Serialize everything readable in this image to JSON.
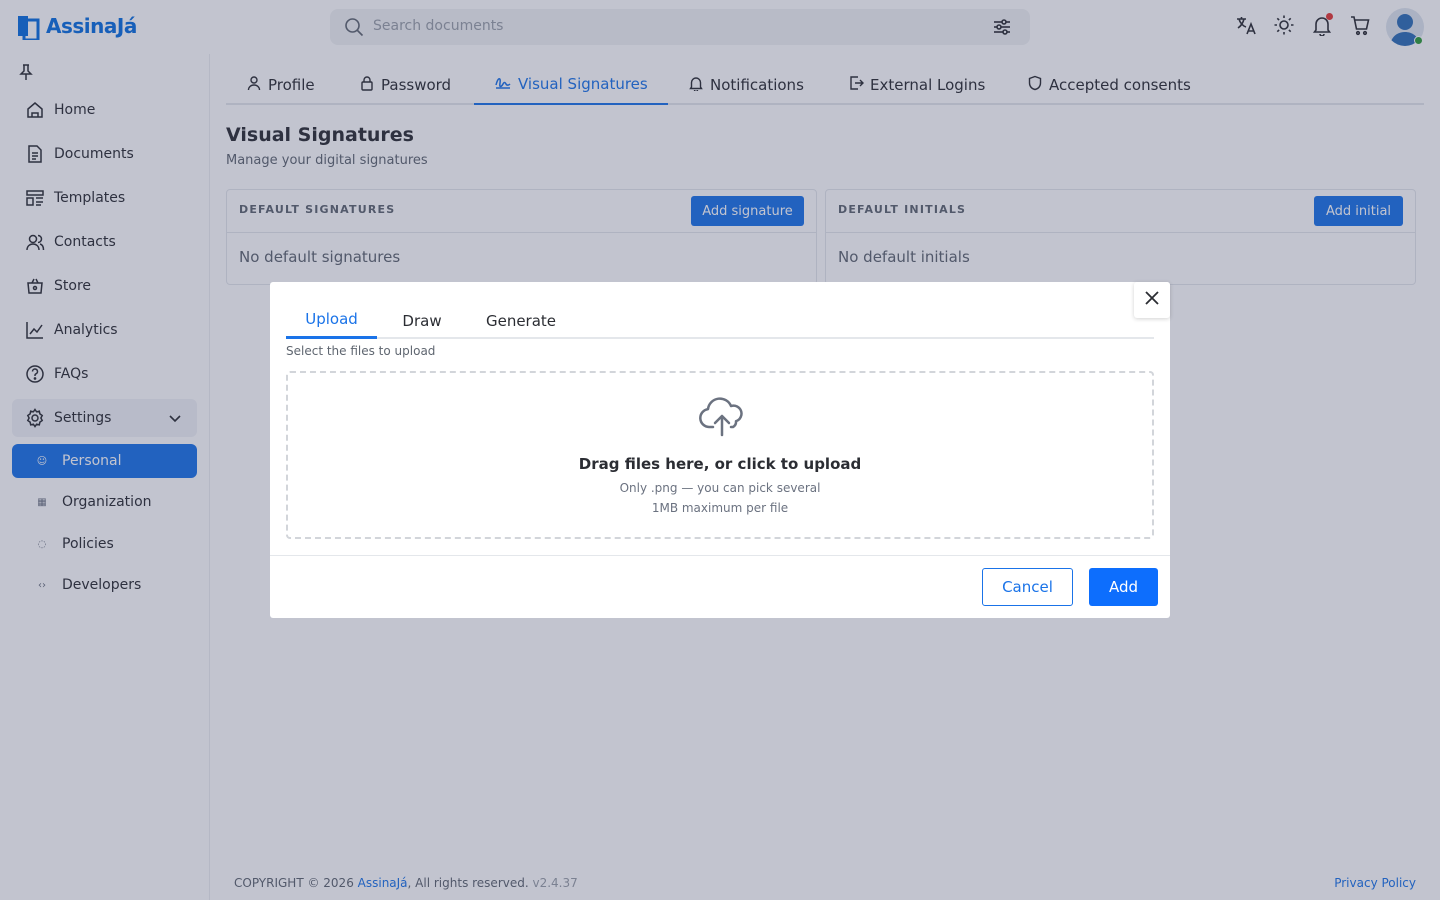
{
  "app": {
    "name": "AssinaJá"
  },
  "colors": {
    "accent": "#1a73e8",
    "primary_button": "#0d6efd",
    "overlay": "#343a60"
  },
  "header": {
    "search_placeholder": "Search documents",
    "icons": [
      "translate-icon",
      "sun-icon",
      "bell-icon",
      "cart-icon",
      "avatar"
    ]
  },
  "sidebar": {
    "items": [
      {
        "label": "Home",
        "icon": "home-icon"
      },
      {
        "label": "Documents",
        "icon": "document-icon"
      },
      {
        "label": "Templates",
        "icon": "template-icon"
      },
      {
        "label": "Contacts",
        "icon": "contacts-icon"
      },
      {
        "label": "Store",
        "icon": "store-icon"
      },
      {
        "label": "Analytics",
        "icon": "analytics-icon"
      },
      {
        "label": "FAQs",
        "icon": "help-icon"
      },
      {
        "label": "Settings",
        "icon": "gear-icon"
      }
    ],
    "settings_sub": [
      {
        "label": "Personal",
        "icon": "person-icon",
        "active": true
      },
      {
        "label": "Organization",
        "icon": "building-icon",
        "active": false
      },
      {
        "label": "Policies",
        "icon": "policy-icon",
        "active": false
      },
      {
        "label": "Developers",
        "icon": "code-icon",
        "active": false
      }
    ]
  },
  "tabs": [
    {
      "label": "Profile",
      "icon": "person-icon"
    },
    {
      "label": "Password",
      "icon": "lock-icon"
    },
    {
      "label": "Visual Signatures",
      "icon": "signature-icon",
      "active": true
    },
    {
      "label": "Notifications",
      "icon": "bell-icon"
    },
    {
      "label": "External Logins",
      "icon": "login-icon"
    },
    {
      "label": "Accepted consents",
      "icon": "shield-icon"
    }
  ],
  "page": {
    "title": "Visual Signatures",
    "subtitle": "Manage your digital signatures"
  },
  "cards": {
    "signatures": {
      "title": "DEFAULT SIGNATURES",
      "button": "Add signature",
      "empty": "No default signatures"
    },
    "initials": {
      "title": "DEFAULT INITIALS",
      "button": "Add initial",
      "empty": "No default initials"
    }
  },
  "footer": {
    "copyright_prefix": "COPYRIGHT © 2026 ",
    "brand": "AssinaJá",
    "rights": ", All rights reserved. ",
    "version": "v2.4.37",
    "privacy": "Privacy Policy"
  },
  "modal": {
    "tabs": [
      {
        "label": "Upload",
        "active": true
      },
      {
        "label": "Draw",
        "active": false
      },
      {
        "label": "Generate",
        "active": false
      }
    ],
    "hint": "Select the files to upload",
    "dropzone": {
      "title": "Drag files here, or click to upload",
      "line1": "Only .png — you can pick several",
      "line2": "1MB maximum per file"
    },
    "cancel": "Cancel",
    "add": "Add"
  }
}
